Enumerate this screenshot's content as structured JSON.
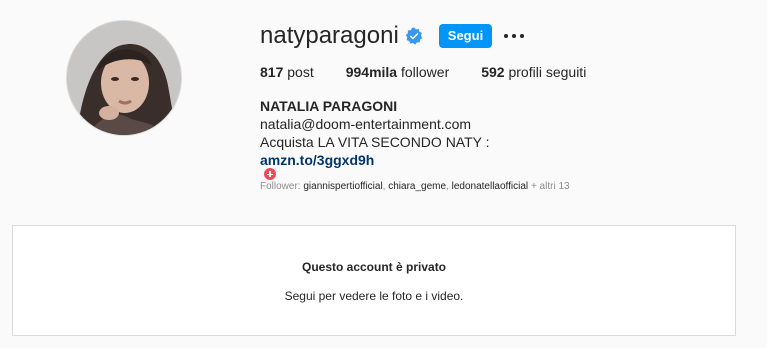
{
  "profile": {
    "username": "natyparagoni",
    "verified": true,
    "follow_label": "Segui",
    "more_label": "•••"
  },
  "stats": {
    "posts_value": "817",
    "posts_label": "post",
    "followers_value": "994mila",
    "followers_label": "follower",
    "following_value": "592",
    "following_label": "profili seguiti"
  },
  "bio": {
    "full_name": "NATALIA PARAGONI",
    "email": "natalia@doom-entertainment.com",
    "line2": "Acquista LA VITA SECONDO NATY :",
    "link": "amzn.to/3ggxd9h"
  },
  "followed_by": {
    "prefix": "Follower:",
    "accounts": [
      "giannispertiofficial",
      "chiara_geme",
      "ledonatellaofficial"
    ],
    "more": "+ altri 13"
  },
  "private": {
    "title": "Questo account è privato",
    "subtitle": "Segui per vedere le foto e i video."
  },
  "colors": {
    "accent": "#0095f6",
    "link": "#00376b",
    "background": "#fafafa",
    "verified": "#3897f0"
  }
}
